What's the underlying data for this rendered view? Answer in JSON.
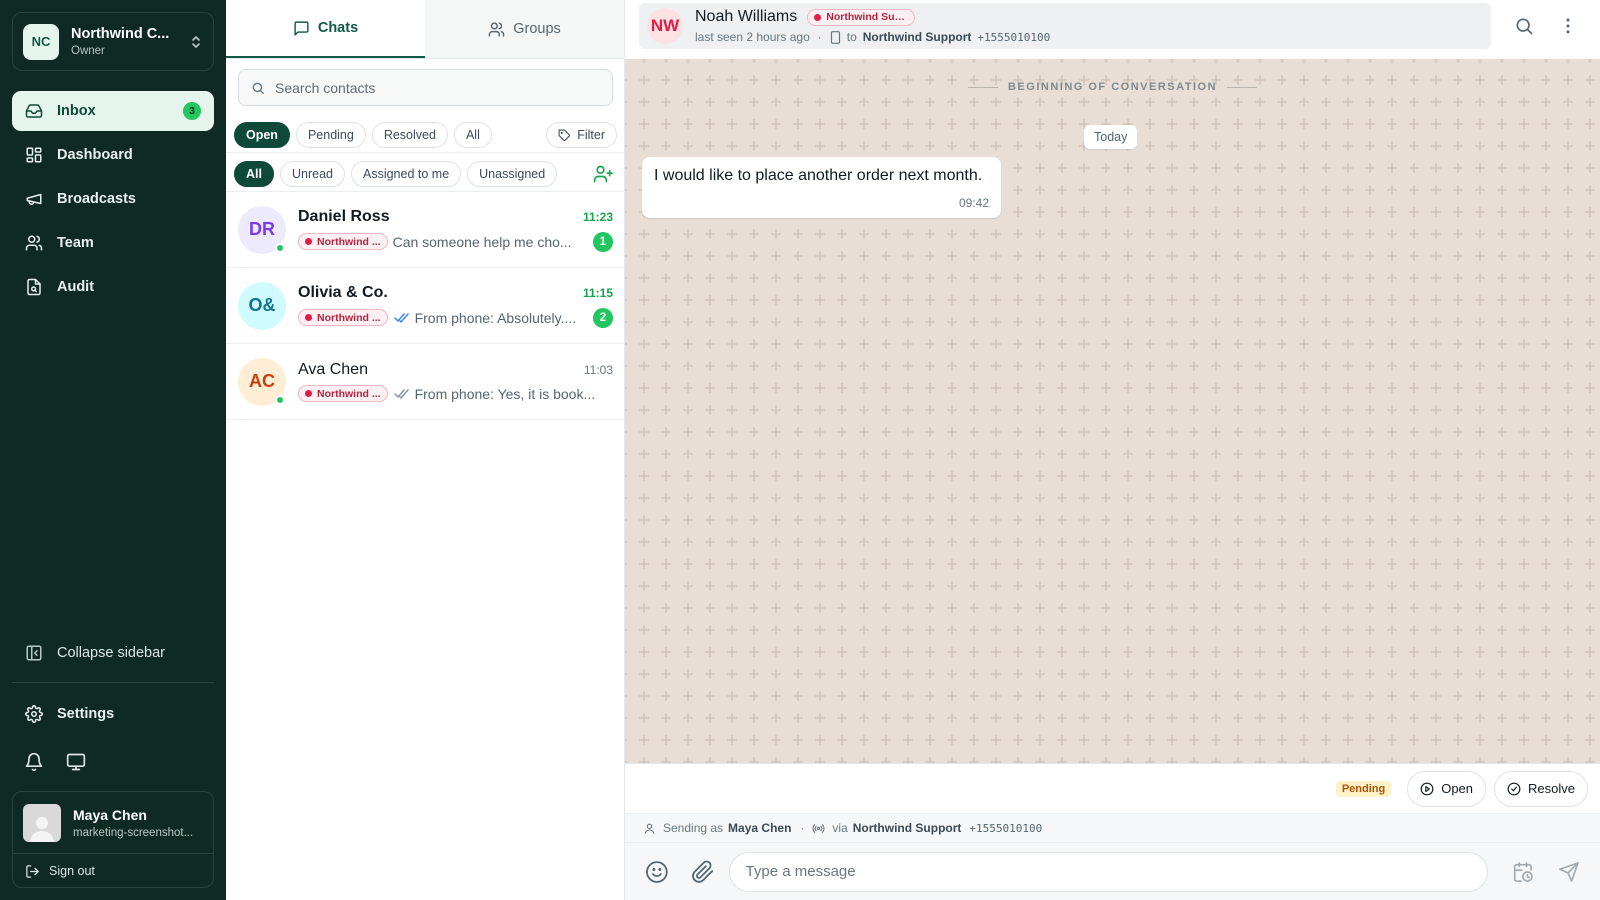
{
  "workspace": {
    "initials": "NC",
    "name": "Northwind C...",
    "role": "Owner"
  },
  "nav": {
    "items": [
      {
        "label": "Inbox",
        "badge": "3"
      },
      {
        "label": "Dashboard"
      },
      {
        "label": "Broadcasts"
      },
      {
        "label": "Team"
      },
      {
        "label": "Audit"
      }
    ],
    "collapse_label": "Collapse sidebar",
    "settings_label": "Settings"
  },
  "user": {
    "name": "Maya Chen",
    "email": "marketing-screenshot...",
    "signout_label": "Sign out"
  },
  "list": {
    "tabs": [
      "Chats",
      "Groups"
    ],
    "search_placeholder": "Search contacts",
    "status_chips": [
      "Open",
      "Pending",
      "Resolved",
      "All"
    ],
    "filter_label": "Filter",
    "assign_chips": [
      "All",
      "Unread",
      "Assigned to me",
      "Unassigned"
    ],
    "chats": [
      {
        "initials": "DR",
        "name": "Daniel Ross",
        "time": "11:23",
        "tag": "Northwind ...",
        "preview": "Can someone help me cho...",
        "unread": "1",
        "online": true,
        "avatar_bg": "#ede9fe",
        "avatar_fg": "#7c3aed"
      },
      {
        "initials": "O&",
        "name": "Olivia & Co.",
        "time": "11:15",
        "tag": "Northwind ...",
        "preview": "From phone: Absolutely....",
        "unread": "2",
        "online": false,
        "avatar_bg": "#cffafe",
        "avatar_fg": "#0e7490"
      },
      {
        "initials": "AC",
        "name": "Ava Chen",
        "time": "11:03",
        "tag": "Northwind ...",
        "preview": "From phone: Yes, it is book...",
        "unread": "",
        "online": true,
        "avatar_bg": "#ffedd5",
        "avatar_fg": "#c2410c"
      }
    ]
  },
  "conversation": {
    "initials": "NW",
    "name": "Noah Williams",
    "tag": "Northwind Sup...",
    "last_seen": "last seen 2 hours ago",
    "to_label": "to",
    "channel": "Northwind Support",
    "number": "+1555010100",
    "beginning_label": "BEGINNING OF CONVERSATION",
    "day_label": "Today",
    "messages": [
      {
        "text": "I would like to place another order next month.",
        "time": "09:42"
      }
    ],
    "status_badge": "Pending",
    "open_label": "Open",
    "resolve_label": "Resolve",
    "sending_prefix": "Sending as",
    "sending_as": "Maya Chen",
    "via_label": "via",
    "composer_placeholder": "Type a message"
  },
  "colors": {
    "sidebar_bg": "#0f2a22",
    "accent": "#0f4a38",
    "unread_green": "#22c55e",
    "tag_red": "#e11d48",
    "chat_bg": "#e8ded6"
  }
}
